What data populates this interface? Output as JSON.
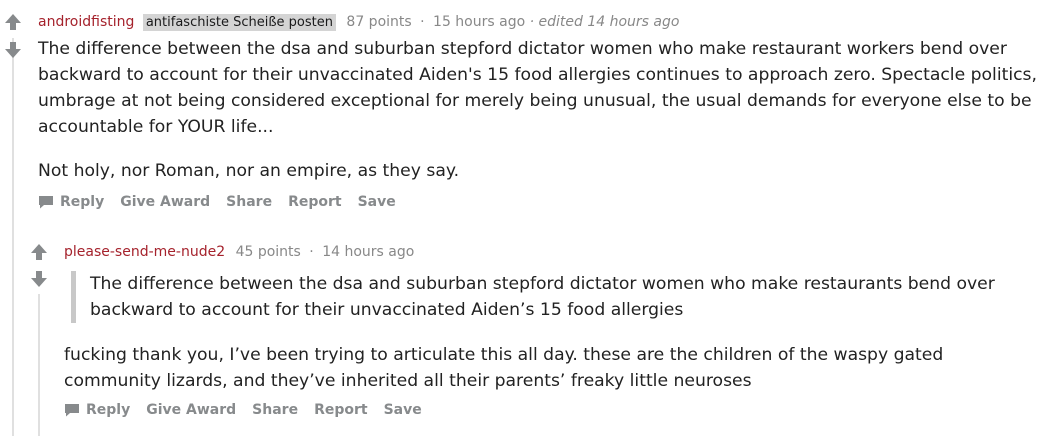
{
  "comments": [
    {
      "author": "androidfisting",
      "flair": "antifaschiste Scheiße posten",
      "score": "87 points",
      "separator": "·",
      "time": "15 hours ago",
      "edited": "· edited 14 hours ago",
      "paragraph1": "The difference between the dsa and suburban stepford dictator women who make restaurant workers bend over backward to account for their unvaccinated Aiden's 15 food allergies continues to approach zero. Spectacle politics, umbrage at not being considered exceptional for merely being unusual, the usual demands for everyone else to be accountable for YOUR life...",
      "paragraph2": "Not holy, nor Roman, nor an empire, as they say.",
      "actions": {
        "reply": "Reply",
        "give_award": "Give Award",
        "share": "Share",
        "report": "Report",
        "save": "Save"
      }
    },
    {
      "author": "please-send-me-nude2",
      "score": "45 points",
      "separator": "·",
      "time": "14 hours ago",
      "quote": "The difference between the dsa and suburban stepford dictator women who make restaurants bend over backward to account for their unvaccinated Aiden’s 15 food allergies",
      "paragraph1": "fucking thank you, I’ve been trying to articulate this all day. these are the children of the waspy gated community lizards, and they’ve inherited all their parents’ freaky little neuroses",
      "actions": {
        "reply": "Reply",
        "give_award": "Give Award",
        "share": "Share",
        "report": "Report",
        "save": "Save"
      }
    }
  ],
  "colors": {
    "author": "#a5222c",
    "muted": "#888888",
    "action": "#878a8c",
    "flair_bg": "#d4d4d4",
    "quote_border": "#c8c8c8",
    "arrow": "#878a8c",
    "thread_line": "#e0e0e0"
  },
  "icons": {
    "upvote": "arrow-up-icon",
    "downvote": "arrow-down-icon",
    "reply": "speech-bubble-icon"
  }
}
